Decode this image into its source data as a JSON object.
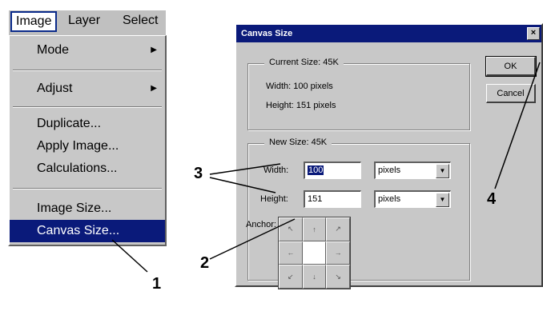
{
  "menubar": {
    "items": [
      {
        "label": "Image"
      },
      {
        "label": "Layer"
      },
      {
        "label": "Select"
      }
    ]
  },
  "menu": {
    "items": [
      {
        "label": "Mode",
        "submenu": true
      },
      {
        "label": "Adjust",
        "submenu": true
      },
      {
        "label": "Duplicate..."
      },
      {
        "label": "Apply Image..."
      },
      {
        "label": "Calculations..."
      },
      {
        "label": "Image Size..."
      },
      {
        "label": "Canvas Size...",
        "selected": true
      }
    ]
  },
  "dialog": {
    "title": "Canvas Size",
    "close": "×",
    "current": {
      "legend": "Current Size: 45K",
      "width": "Width: 100 pixels",
      "height": "Height: 151 pixels"
    },
    "new": {
      "legend": "New Size: 45K",
      "width_label": "Width:",
      "width_value": "100",
      "height_label": "Height:",
      "height_value": "151",
      "unit": "pixels",
      "anchor_label": "Anchor:"
    },
    "ok": "OK",
    "cancel": "Cancel"
  },
  "callouts": {
    "one": "1",
    "two": "2",
    "three": "3",
    "four": "4"
  },
  "colors": {
    "highlight": "#0a1a7a",
    "face": "#c8c8c8"
  }
}
